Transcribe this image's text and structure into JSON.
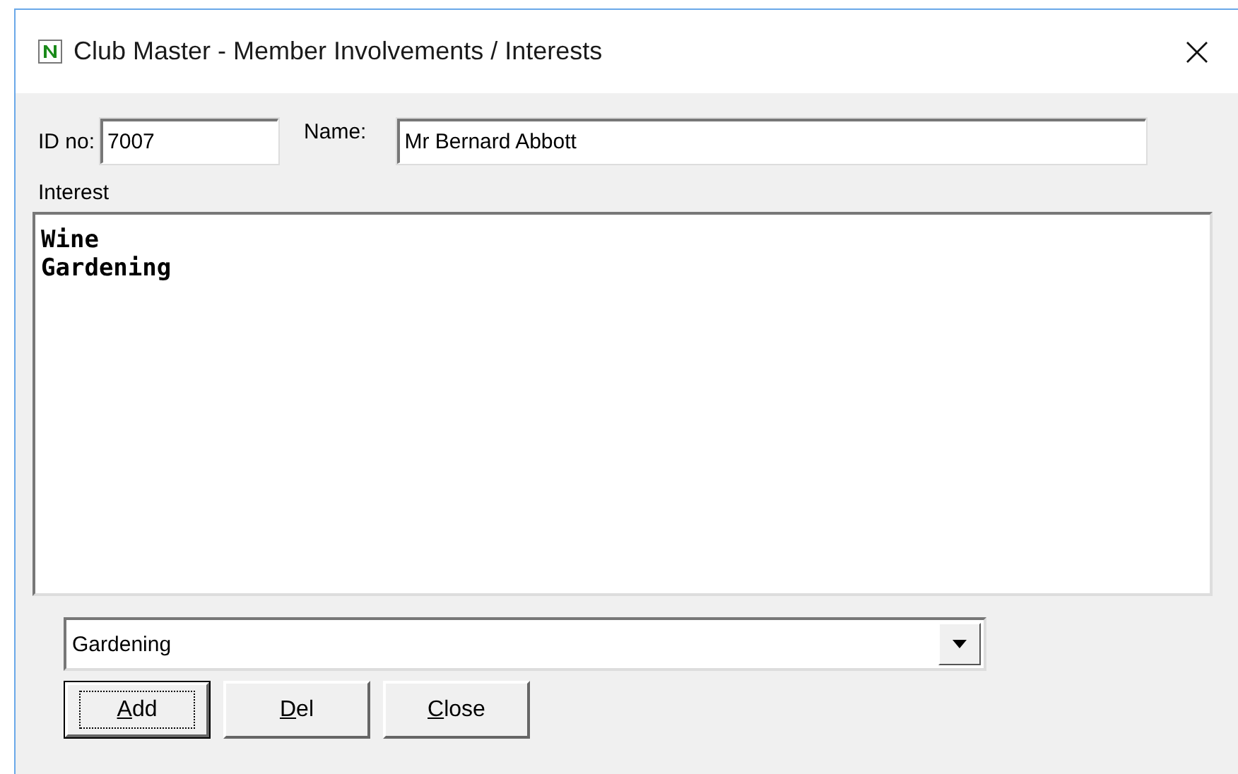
{
  "window": {
    "title": "Club Master - Member Involvements / Interests"
  },
  "id_field": {
    "label": "ID no:",
    "value": "7007"
  },
  "name_field": {
    "label": "Name:",
    "value": "Mr Bernard Abbott"
  },
  "interest": {
    "label": "Interest",
    "lines": [
      "Wine",
      "Gardening"
    ]
  },
  "combo": {
    "value": "Gardening"
  },
  "buttons": [
    {
      "label": "Add",
      "default": true,
      "focused": true
    },
    {
      "label": "Del",
      "default": false,
      "focused": false
    },
    {
      "label": "Close",
      "default": false,
      "focused": false
    }
  ]
}
